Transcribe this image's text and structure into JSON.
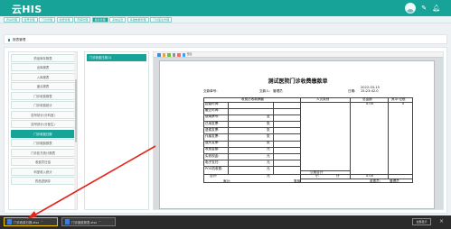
{
  "app": {
    "logo": "云HIS"
  },
  "header": {
    "icons": [
      "avatar-icon",
      "pencil-icon",
      "bell-icon"
    ],
    "user_line1": "ⓘ",
    "user_line2": ""
  },
  "modnav": {
    "tabs": [
      {
        "label": "药房管理",
        "active": false
      },
      {
        "label": "挂号管理",
        "active": false
      },
      {
        "label": "门诊管理",
        "active": false
      },
      {
        "label": "收费管理",
        "active": false
      },
      {
        "label": "药库管理",
        "active": false
      },
      {
        "label": "报表管理",
        "active": true
      },
      {
        "label": "系统设置",
        "active": false
      },
      {
        "label": "基础数据管理",
        "active": false
      },
      {
        "label": "门诊医生管理",
        "active": false
      }
    ]
  },
  "page": {
    "title": "报表管理"
  },
  "sidebar": {
    "items": [
      {
        "label": "药品库存报表",
        "active": false
      },
      {
        "label": "出库报表",
        "active": false
      },
      {
        "label": "入库报表",
        "active": false
      },
      {
        "label": "盘点报表",
        "active": false
      },
      {
        "label": "门诊收费报表",
        "active": false
      },
      {
        "label": "门诊收费统计",
        "active": false
      },
      {
        "label": "挂号统计(分科室)",
        "active": false
      },
      {
        "label": "挂号统计(分医生)",
        "active": false
      },
      {
        "label": "门诊收费日报",
        "active": true
      },
      {
        "label": "门诊缴费报表",
        "active": false
      },
      {
        "label": "门诊处方统计报表",
        "active": false
      },
      {
        "label": "收费员日结",
        "active": false
      },
      {
        "label": "科室收入统计",
        "active": false
      },
      {
        "label": "药品进销存",
        "active": false
      }
    ]
  },
  "report_list": {
    "items": [
      "门诊收费日报(1)"
    ]
  },
  "preview": {
    "toolbar_label": "预览",
    "toolbar_colors": [
      "#3a8ee6",
      "#e6a23c",
      "#67c23a",
      "#909399",
      "#f56c6c",
      "#409eff"
    ],
    "report": {
      "title": "测试医院门诊收费缴款单",
      "trade_no_label": "交款单号:",
      "payer_label": "交款人:",
      "payer_value": "管理员",
      "date_label": "日期:",
      "date_value": "2022-03-15 15:23:42.0",
      "col_summary": "收费员收款摘要",
      "col_person_type": "人员类别",
      "col_total": "总金额",
      "col_other": "其中:记账",
      "rows": [
        {
          "label": "起始时间:",
          "value": ""
        },
        {
          "label": "截止时间:",
          "value": ""
        },
        {
          "label": "使用票号:",
          "value": "至"
        },
        {
          "label": "已用发票:",
          "value": "张"
        },
        {
          "label": "退费发票:",
          "value": "张"
        },
        {
          "label": "作废发票:",
          "value": "张"
        },
        {
          "label": "遗失发票:",
          "value": "张"
        },
        {
          "label": "收费金额:",
          "value": "元"
        },
        {
          "label": "实收现金:",
          "value": "元"
        },
        {
          "label": "电子支付:",
          "value": "元"
        },
        {
          "label": "POS机收费:",
          "value": "元"
        }
      ],
      "total_value": "0.00",
      "total_other": "0",
      "public_total_label": "公费合计",
      "sum_label": "合计:",
      "sum_unit": "元",
      "subtotal_label": "小",
      "subtotal_label2": "计",
      "subtotal_value": "0.00",
      "review_label": "审计:",
      "reviewer_label": "复核:",
      "cashier_label": "收费员:",
      "cashier_value": "管理员"
    }
  },
  "taskbar": {
    "downloads": [
      {
        "name": "门诊收费日报.xlsx",
        "highlighted": true
      },
      {
        "name": "门诊缴费报表.xlsx",
        "highlighted": false
      }
    ],
    "show_all": "全部显示",
    "close": "×"
  }
}
